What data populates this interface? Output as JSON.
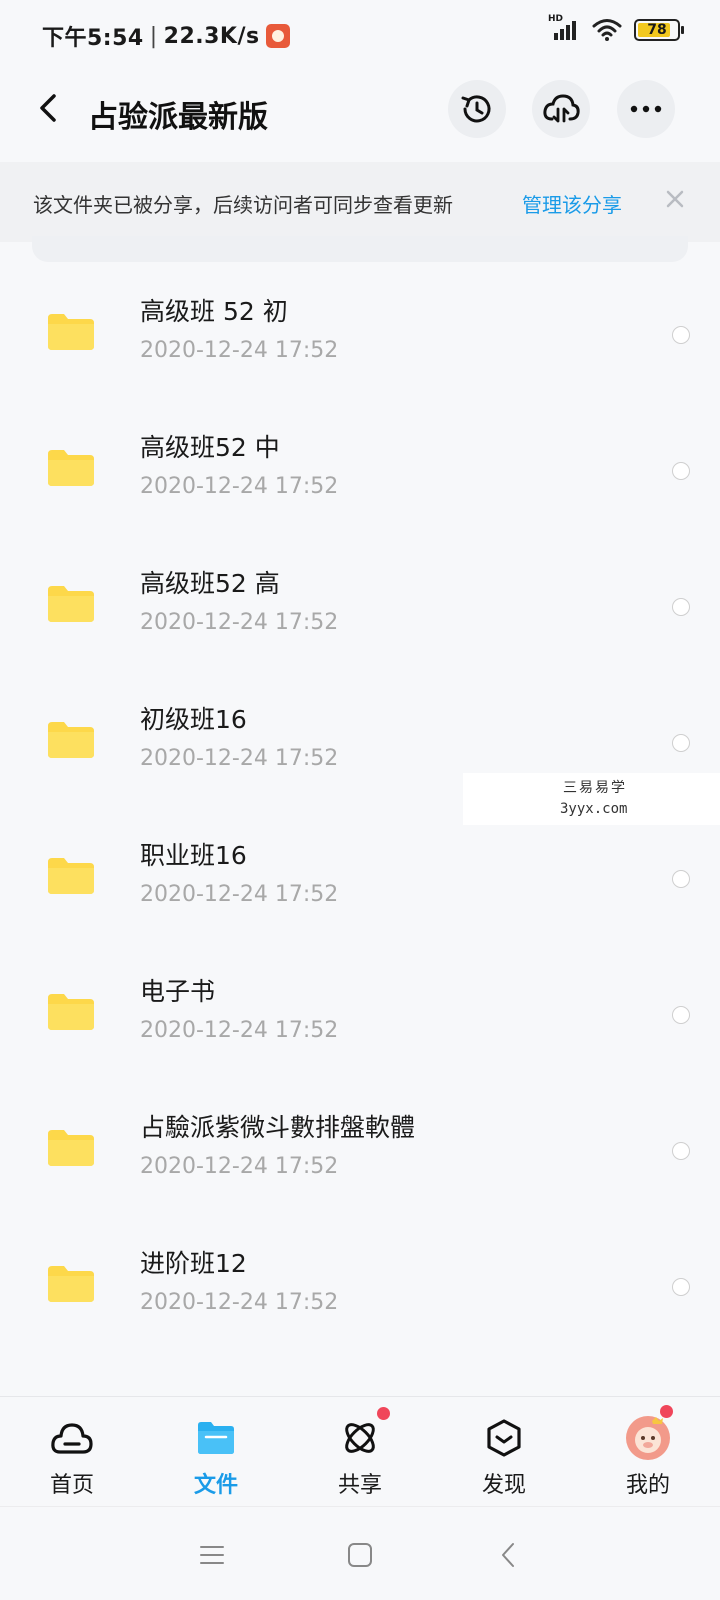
{
  "status_bar": {
    "time": "下午5:54",
    "speed": "22.3K/s",
    "network_label": "HD",
    "battery": "78"
  },
  "header": {
    "title": "占验派最新版",
    "icons": [
      "back-arrow-icon",
      "history-icon",
      "cloud-transfer-icon",
      "more-icon"
    ]
  },
  "banner": {
    "text": "该文件夹已被分享，后续访问者可同步查看更新",
    "link": "管理该分享"
  },
  "files": [
    {
      "name": "高级班 52 初",
      "date": "2020-12-24  17:52"
    },
    {
      "name": "高级班52 中",
      "date": "2020-12-24  17:52"
    },
    {
      "name": "高级班52  高",
      "date": "2020-12-24  17:52"
    },
    {
      "name": "初级班16",
      "date": "2020-12-24  17:52"
    },
    {
      "name": "职业班16",
      "date": "2020-12-24  17:52"
    },
    {
      "name": "电子书",
      "date": "2020-12-24  17:52"
    },
    {
      "name": "占驗派紫微斗數排盤軟體",
      "date": "2020-12-24  17:52"
    },
    {
      "name": "进阶班12",
      "date": "2020-12-24  17:52"
    }
  ],
  "watermark": {
    "line1": "三易易学",
    "line2": "3yyx.com"
  },
  "bottom_nav": [
    {
      "label": "首页",
      "icon": "cloud-home-icon"
    },
    {
      "label": "文件",
      "icon": "folder-icon",
      "active": true
    },
    {
      "label": "共享",
      "icon": "share-orbit-icon"
    },
    {
      "label": "发现",
      "icon": "discover-box-icon"
    },
    {
      "label": "我的",
      "icon": "avatar-icon"
    }
  ],
  "colors": {
    "accent": "#1a9be8",
    "folder": "#fdd84a",
    "badge": "#f0465a"
  }
}
